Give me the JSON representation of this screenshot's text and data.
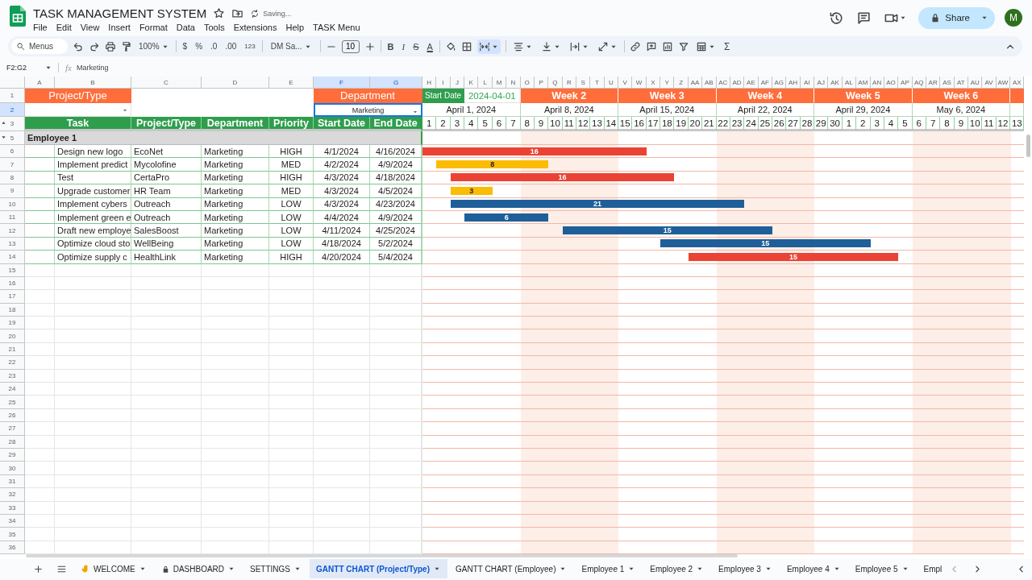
{
  "app": {
    "title": "TASK MANAGEMENT SYSTEM",
    "status": "Saving...",
    "menus": [
      "File",
      "Edit",
      "View",
      "Insert",
      "Format",
      "Data",
      "Tools",
      "Extensions",
      "Help",
      "TASK Menu"
    ],
    "share": "Share",
    "avatar": "M"
  },
  "toolbar": {
    "search_placeholder": "Menus",
    "zoom": "100%",
    "currency": "$",
    "percent": "%",
    "decimal_decrease": ".0",
    "decimal_increase": ".00",
    "number_format": "123",
    "font": "DM Sa...",
    "font_size": "10",
    "bold": "B",
    "italic": "I",
    "strikethrough": "S",
    "text_color": "A",
    "sigma": "Σ",
    "merge_active": true
  },
  "formula_bar": {
    "range": "F2:G2",
    "fx": "fx",
    "value": "Marketing"
  },
  "columns": [
    {
      "label": "A",
      "selected": false
    },
    {
      "label": "B",
      "selected": false
    },
    {
      "label": "C",
      "selected": false
    },
    {
      "label": "D",
      "selected": false
    },
    {
      "label": "E",
      "selected": false
    },
    {
      "label": "F",
      "selected": true
    },
    {
      "label": "G",
      "selected": true
    },
    {
      "label": "H",
      "selected": false
    },
    {
      "label": "I",
      "selected": false
    },
    {
      "label": "J",
      "selected": false
    },
    {
      "label": "K",
      "selected": false
    },
    {
      "label": "L",
      "selected": false
    },
    {
      "label": "M",
      "selected": false
    },
    {
      "label": "N",
      "selected": false
    },
    {
      "label": "O",
      "selected": false
    },
    {
      "label": "P",
      "selected": false
    },
    {
      "label": "Q",
      "selected": false
    },
    {
      "label": "R",
      "selected": false
    },
    {
      "label": "S",
      "selected": false
    },
    {
      "label": "T",
      "selected": false
    },
    {
      "label": "U",
      "selected": false
    },
    {
      "label": "V",
      "selected": false
    },
    {
      "label": "W",
      "selected": false
    },
    {
      "label": "X",
      "selected": false
    },
    {
      "label": "Y",
      "selected": false
    },
    {
      "label": "Z",
      "selected": false
    },
    {
      "label": "AA",
      "selected": false
    },
    {
      "label": "AB",
      "selected": false
    },
    {
      "label": "AC",
      "selected": false
    },
    {
      "label": "AD",
      "selected": false
    },
    {
      "label": "AE",
      "selected": false
    },
    {
      "label": "AF",
      "selected": false
    },
    {
      "label": "AG",
      "selected": false
    },
    {
      "label": "AH",
      "selected": false
    },
    {
      "label": "AI",
      "selected": false
    },
    {
      "label": "AJ",
      "selected": false
    },
    {
      "label": "AK",
      "selected": false
    },
    {
      "label": "AL",
      "selected": false
    },
    {
      "label": "AM",
      "selected": false
    },
    {
      "label": "AN",
      "selected": false
    },
    {
      "label": "AO",
      "selected": false
    },
    {
      "label": "AP",
      "selected": false
    },
    {
      "label": "AQ",
      "selected": false
    },
    {
      "label": "AR",
      "selected": false
    },
    {
      "label": "AS",
      "selected": false
    },
    {
      "label": "AT",
      "selected": false
    },
    {
      "label": "AU",
      "selected": false
    },
    {
      "label": "AV",
      "selected": false
    },
    {
      "label": "AW",
      "selected": false
    },
    {
      "label": "AX",
      "selected": false
    }
  ],
  "rows": [
    {
      "label": "1",
      "selected": false
    },
    {
      "label": "2",
      "selected": true
    },
    {
      "label": "3",
      "selected": false
    },
    {
      "label": "5",
      "selected": false
    },
    {
      "label": "6",
      "selected": false
    },
    {
      "label": "7",
      "selected": false
    },
    {
      "label": "8",
      "selected": false
    },
    {
      "label": "9",
      "selected": false
    },
    {
      "label": "10",
      "selected": false
    },
    {
      "label": "11",
      "selected": false
    },
    {
      "label": "12",
      "selected": false
    },
    {
      "label": "13",
      "selected": false
    },
    {
      "label": "14",
      "selected": false
    },
    {
      "label": "15",
      "selected": false
    },
    {
      "label": "16",
      "selected": false
    },
    {
      "label": "17",
      "selected": false
    },
    {
      "label": "18",
      "selected": false
    },
    {
      "label": "19",
      "selected": false
    },
    {
      "label": "20",
      "selected": false
    },
    {
      "label": "21",
      "selected": false
    },
    {
      "label": "22",
      "selected": false
    },
    {
      "label": "23",
      "selected": false
    },
    {
      "label": "24",
      "selected": false
    },
    {
      "label": "25",
      "selected": false
    },
    {
      "label": "26",
      "selected": false
    },
    {
      "label": "27",
      "selected": false
    },
    {
      "label": "28",
      "selected": false
    },
    {
      "label": "29",
      "selected": false
    },
    {
      "label": "30",
      "selected": false
    },
    {
      "label": "31",
      "selected": false
    },
    {
      "label": "32",
      "selected": false
    },
    {
      "label": "33",
      "selected": false
    },
    {
      "label": "34",
      "selected": false
    },
    {
      "label": "35",
      "selected": false
    },
    {
      "label": "36",
      "selected": false
    }
  ],
  "filters": {
    "project_label": "Project/Type",
    "department_label": "Department",
    "department_value": "Marketing"
  },
  "timeline": {
    "start_label": "Start Date",
    "start_value": "2024-04-01",
    "weeks": [
      "Week 2",
      "Week 3",
      "Week 4",
      "Week 5",
      "Week 6"
    ],
    "week_dates": [
      "April 1, 2024",
      "April 8, 2024",
      "April 15, 2024",
      "April 22, 2024",
      "April 29, 2024",
      "May 6, 2024"
    ],
    "days": [
      "1",
      "2",
      "3",
      "4",
      "5",
      "6",
      "7",
      "8",
      "9",
      "10",
      "11",
      "12",
      "13",
      "14",
      "15",
      "16",
      "17",
      "18",
      "19",
      "20",
      "21",
      "22",
      "23",
      "24",
      "25",
      "26",
      "27",
      "28",
      "29",
      "30",
      "1",
      "2",
      "3",
      "4",
      "5",
      "6",
      "7",
      "8",
      "9",
      "10",
      "11",
      "12",
      "13"
    ]
  },
  "headers": [
    "Task",
    "Project/Type",
    "Department",
    "Priority",
    "Start Date",
    "End Date"
  ],
  "group": {
    "label": "Employee 1",
    "expanded": true
  },
  "tasks": [
    {
      "task": "Design new logo",
      "project": "EcoNet",
      "department": "Marketing",
      "priority": "HIGH",
      "start": "4/1/2024",
      "end": "4/16/2024",
      "days": "16",
      "color": "#ea4335"
    },
    {
      "task": "Implement predict",
      "project": "Mycolofine",
      "department": "Marketing",
      "priority": "MED",
      "start": "4/2/2024",
      "end": "4/9/2024",
      "days": "8",
      "color": "#fbbc04"
    },
    {
      "task": "Test",
      "project": "CertaPro",
      "department": "Marketing",
      "priority": "HIGH",
      "start": "4/3/2024",
      "end": "4/18/2024",
      "days": "16",
      "color": "#ea4335"
    },
    {
      "task": "Upgrade customer",
      "project": "HR Team",
      "department": "Marketing",
      "priority": "MED",
      "start": "4/3/2024",
      "end": "4/5/2024",
      "days": "3",
      "color": "#fbbc04"
    },
    {
      "task": "Implement cybers",
      "project": "Outreach",
      "department": "Marketing",
      "priority": "LOW",
      "start": "4/3/2024",
      "end": "4/23/2024",
      "days": "21",
      "color": "#1f5f99"
    },
    {
      "task": "Implement green e",
      "project": "Outreach",
      "department": "Marketing",
      "priority": "LOW",
      "start": "4/4/2024",
      "end": "4/9/2024",
      "days": "6",
      "color": "#1f5f99"
    },
    {
      "task": "Draft new employe",
      "project": "SalesBoost",
      "department": "Marketing",
      "priority": "LOW",
      "start": "4/11/2024",
      "end": "4/25/2024",
      "days": "15",
      "color": "#1f5f99"
    },
    {
      "task": "Optimize cloud sto",
      "project": "WellBeing",
      "department": "Marketing",
      "priority": "LOW",
      "start": "4/18/2024",
      "end": "5/2/2024",
      "days": "15",
      "color": "#1f5f99"
    },
    {
      "task": "Optimize supply c",
      "project": "HealthLink",
      "department": "Marketing",
      "priority": "HIGH",
      "start": "4/20/2024",
      "end": "5/4/2024",
      "days": "15",
      "color": "#ea4335"
    }
  ],
  "sheet_tabs": [
    {
      "label": "WELCOME",
      "kind": "hand",
      "selected": false
    },
    {
      "label": "DASHBOARD",
      "kind": "lock",
      "selected": false
    },
    {
      "label": "SETTINGS",
      "kind": "plain",
      "selected": false
    },
    {
      "label": "GANTT CHART (Project/Type)",
      "kind": "plain",
      "selected": true
    },
    {
      "label": "GANTT CHART (Employee)",
      "kind": "plain",
      "selected": false
    },
    {
      "label": "Employee 1",
      "kind": "plain",
      "selected": false
    },
    {
      "label": "Employee 2",
      "kind": "plain",
      "selected": false
    },
    {
      "label": "Employee 3",
      "kind": "plain",
      "selected": false
    },
    {
      "label": "Employee 4",
      "kind": "plain",
      "selected": false
    },
    {
      "label": "Employee 5",
      "kind": "plain",
      "selected": false
    },
    {
      "label": "Empl",
      "kind": "cut",
      "selected": false
    }
  ]
}
